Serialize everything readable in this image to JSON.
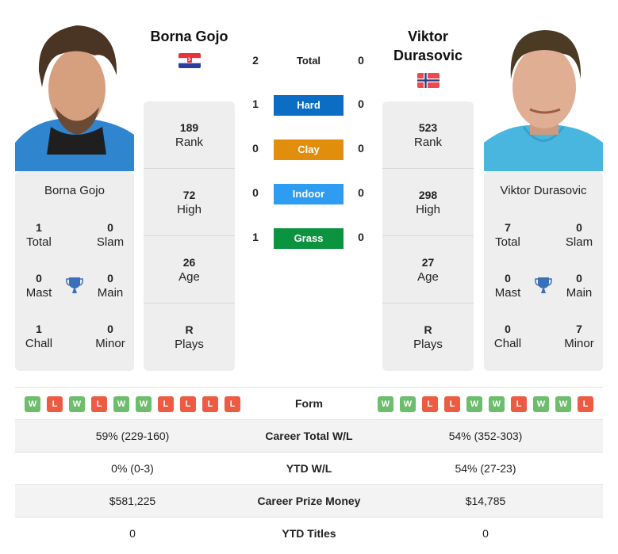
{
  "colors": {
    "hard": "#0b6ec4",
    "clay": "#e08e0b",
    "indoor": "#2e9cf1",
    "grass": "#0b9340",
    "win": "#6cbd6c",
    "loss": "#ee5b43",
    "trophy": "#3a6fba"
  },
  "player1": {
    "name": "Borna Gojo",
    "flag": "croatia-flag",
    "rank": "189",
    "rank_label": "Rank",
    "high": "72",
    "high_label": "High",
    "age": "26",
    "age_label": "Age",
    "plays": "R",
    "plays_label": "Plays",
    "titles": {
      "total": "1",
      "total_label": "Total",
      "slam": "0",
      "slam_label": "Slam",
      "mast": "0",
      "mast_label": "Mast",
      "main": "0",
      "main_label": "Main",
      "chall": "1",
      "chall_label": "Chall",
      "minor": "0",
      "minor_label": "Minor"
    },
    "form": [
      "W",
      "L",
      "W",
      "L",
      "W",
      "W",
      "L",
      "L",
      "L",
      "L"
    ],
    "career_wl": "59% (229-160)",
    "ytd_wl": "0% (0-3)",
    "prize_money": "$581,225",
    "ytd_titles": "0"
  },
  "player2": {
    "name_line1": "Viktor",
    "name_line2": "Durasovic",
    "name": "Viktor Durasovic",
    "flag": "norway-flag",
    "rank": "523",
    "rank_label": "Rank",
    "high": "298",
    "high_label": "High",
    "age": "27",
    "age_label": "Age",
    "plays": "R",
    "plays_label": "Plays",
    "titles": {
      "total": "7",
      "total_label": "Total",
      "slam": "0",
      "slam_label": "Slam",
      "mast": "0",
      "mast_label": "Mast",
      "main": "0",
      "main_label": "Main",
      "chall": "0",
      "chall_label": "Chall",
      "minor": "7",
      "minor_label": "Minor"
    },
    "form": [
      "W",
      "W",
      "L",
      "L",
      "W",
      "W",
      "L",
      "W",
      "W",
      "L"
    ],
    "career_wl": "54% (352-303)",
    "ytd_wl": "54% (27-23)",
    "prize_money": "$14,785",
    "ytd_titles": "0"
  },
  "h2h": {
    "total": {
      "label": "Total",
      "p1": "2",
      "p2": "0"
    },
    "surfaces": [
      {
        "label": "Hard",
        "p1": "1",
        "p2": "0"
      },
      {
        "label": "Clay",
        "p1": "0",
        "p2": "0"
      },
      {
        "label": "Indoor",
        "p1": "0",
        "p2": "0"
      },
      {
        "label": "Grass",
        "p1": "1",
        "p2": "0"
      }
    ]
  },
  "table": {
    "form_label": "Form",
    "career_wl_label": "Career Total W/L",
    "ytd_wl_label": "YTD W/L",
    "prize_label": "Career Prize Money",
    "ytd_titles_label": "YTD Titles"
  }
}
